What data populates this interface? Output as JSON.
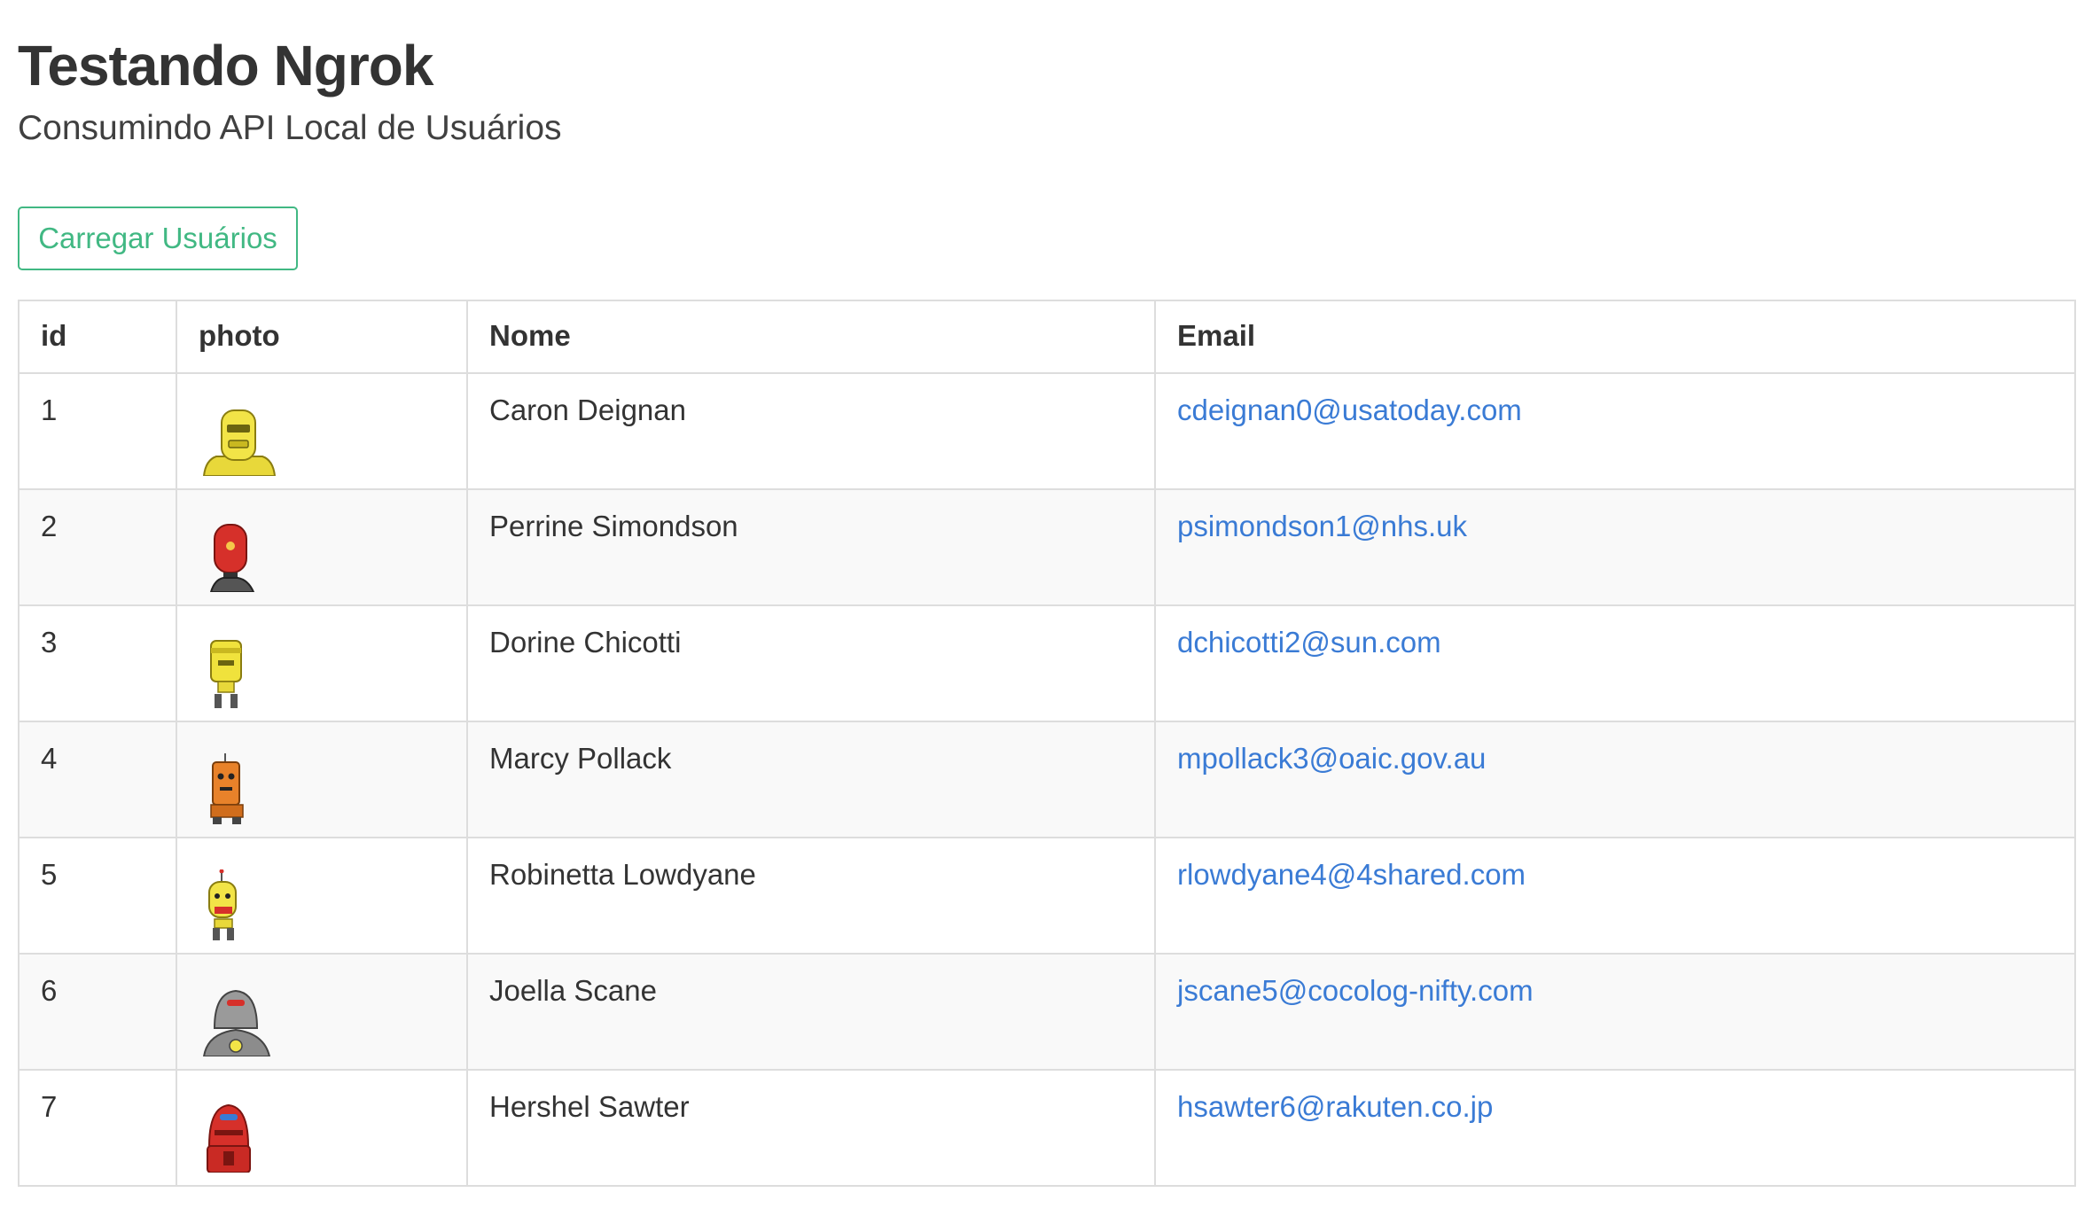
{
  "header": {
    "title": "Testando Ngrok",
    "subtitle": "Consumindo API Local de Usuários"
  },
  "actions": {
    "load_label": "Carregar Usuários"
  },
  "table": {
    "columns": [
      "id",
      "photo",
      "Nome",
      "Email"
    ],
    "rows": [
      {
        "id": "1",
        "photo": "yellow-robot-avatar",
        "nome": "Caron Deignan",
        "email": "cdeignan0@usatoday.com"
      },
      {
        "id": "2",
        "photo": "red-robot-avatar",
        "nome": "Perrine Simondson",
        "email": "psimondson1@nhs.uk"
      },
      {
        "id": "3",
        "photo": "yellow-robot-avatar",
        "nome": "Dorine Chicotti",
        "email": "dchicotti2@sun.com"
      },
      {
        "id": "4",
        "photo": "orange-robot-avatar",
        "nome": "Marcy Pollack",
        "email": "mpollack3@oaic.gov.au"
      },
      {
        "id": "5",
        "photo": "yellow-robot-avatar",
        "nome": "Robinetta Lowdyane",
        "email": "rlowdyane4@4shared.com"
      },
      {
        "id": "6",
        "photo": "gray-robot-avatar",
        "nome": "Joella Scane",
        "email": "jscane5@cocolog-nifty.com"
      },
      {
        "id": "7",
        "photo": "red-robot-avatar",
        "nome": "Hershel Sawter",
        "email": "hsawter6@rakuten.co.jp"
      }
    ]
  },
  "colors": {
    "accent": "#41b883",
    "link": "#3a7bd5",
    "text": "#333333",
    "border": "#dddddd",
    "stripe": "#f9f9f9"
  }
}
